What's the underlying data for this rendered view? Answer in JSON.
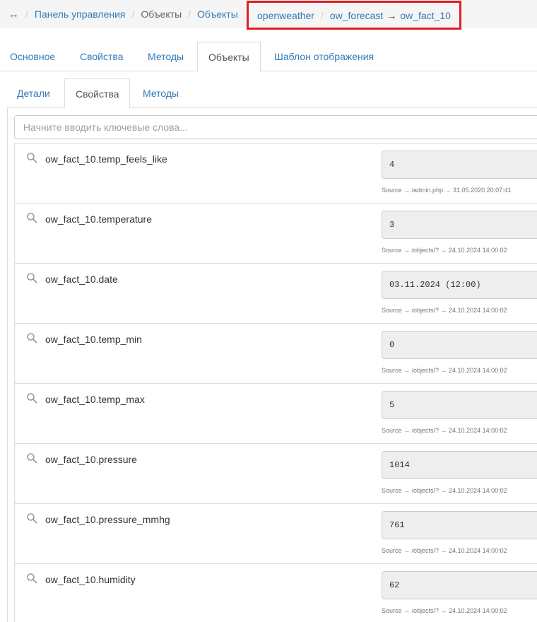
{
  "breadcrumb": {
    "nav_icon": "↔",
    "items": [
      "Панель управления",
      "Объекты",
      "Объекты"
    ],
    "highlighted": {
      "class": "openweather",
      "parent": "ow_forecast",
      "arrow": "→",
      "object": "ow_fact_10"
    },
    "separator": "/"
  },
  "tabs": [
    "Основное",
    "Свойства",
    "Методы",
    "Объекты",
    "Шаблон отображения"
  ],
  "subtabs": [
    "Детали",
    "Свойства",
    "Методы"
  ],
  "search": {
    "placeholder": "Начните вводить ключевые слова..."
  },
  "properties": [
    {
      "name": "ow_fact_10.temp_feels_like",
      "value": "4",
      "source": "Source → /admin.php → 31.05.2020 20:07:41"
    },
    {
      "name": "ow_fact_10.temperature",
      "value": "3",
      "source": "Source → /objects/? → 24.10.2024 14:00:02"
    },
    {
      "name": "ow_fact_10.date",
      "value": "03.11.2024 (12:00)",
      "source": "Source → /objects/? → 24.10.2024 14:00:02"
    },
    {
      "name": "ow_fact_10.temp_min",
      "value": "0",
      "source": "Source → /objects/? → 24.10.2024 14:00:02"
    },
    {
      "name": "ow_fact_10.temp_max",
      "value": "5",
      "source": "Source → /objects/? → 24.10.2024 14:00:02"
    },
    {
      "name": "ow_fact_10.pressure",
      "value": "1014",
      "source": "Source → /objects/? → 24.10.2024 14:00:02"
    },
    {
      "name": "ow_fact_10.pressure_mmhg",
      "value": "761",
      "source": "Source → /objects/? → 24.10.2024 14:00:02"
    },
    {
      "name": "ow_fact_10.humidity",
      "value": "62",
      "source": "Source → /objects/? → 24.10.2024 14:00:02"
    }
  ],
  "colors": {
    "link": "#337ab7",
    "highlight_border": "#e21d23",
    "breadcrumb_bg": "#f5f5f5"
  }
}
